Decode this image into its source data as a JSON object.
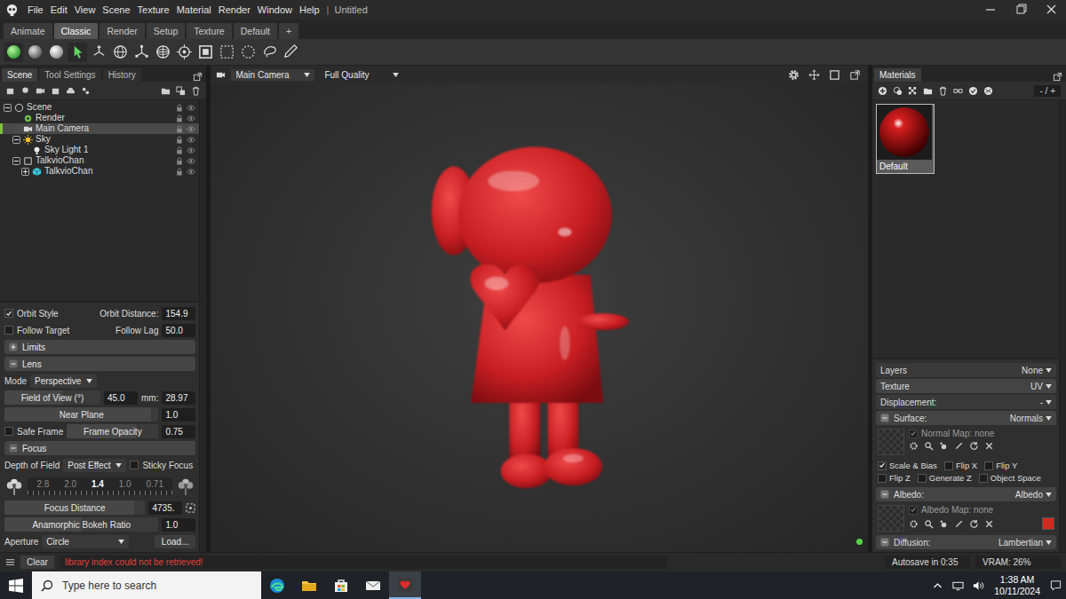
{
  "window": {
    "title": "Untitled",
    "menus": [
      "File",
      "Edit",
      "View",
      "Scene",
      "Texture",
      "Material",
      "Render",
      "Window",
      "Help"
    ],
    "separator": "|"
  },
  "workspace_tabs": [
    {
      "label": "Animate",
      "selected": false
    },
    {
      "label": "Classic",
      "selected": true
    },
    {
      "label": "Render",
      "selected": false
    },
    {
      "label": "Setup",
      "selected": false
    },
    {
      "label": "Texture",
      "selected": false
    },
    {
      "label": "Default",
      "selected": false
    },
    {
      "label": "+",
      "selected": false
    }
  ],
  "toolbar": {
    "tools": [
      {
        "kind": "shade-lit",
        "selected": true
      },
      {
        "kind": "shade-gray",
        "selected": false
      },
      {
        "kind": "shade-white",
        "selected": false
      },
      {
        "kind": "select",
        "selected": true
      },
      {
        "kind": "move",
        "selected": false
      },
      {
        "kind": "rotate",
        "selected": false
      },
      {
        "kind": "scale",
        "selected": false
      },
      {
        "kind": "transform",
        "selected": false
      },
      {
        "kind": "pivot",
        "selected": false
      },
      {
        "kind": "frame",
        "selected": false
      },
      {
        "kind": "marquee",
        "selected": false
      },
      {
        "kind": "ellipse",
        "selected": false
      },
      {
        "kind": "lasso",
        "selected": false
      },
      {
        "kind": "paint",
        "selected": false
      }
    ]
  },
  "scene_panel": {
    "tabs": [
      {
        "label": "Scene",
        "selected": true
      },
      {
        "label": "Tool Settings",
        "selected": false
      },
      {
        "label": "History",
        "selected": false
      }
    ],
    "tree": [
      {
        "label": "Scene",
        "kind": "scene",
        "expanded": true,
        "selected": false,
        "children": [
          {
            "label": "Render",
            "kind": "render",
            "selected": false
          },
          {
            "label": "Main Camera",
            "kind": "camera",
            "selected": true
          },
          {
            "label": "Sky",
            "kind": "sky",
            "expanded": true,
            "selected": false,
            "children": [
              {
                "label": "Sky Light 1",
                "kind": "light",
                "selected": false
              }
            ]
          },
          {
            "label": "TalkvioChan",
            "kind": "group",
            "expanded": true,
            "selected": false,
            "children": [
              {
                "label": "TalkvioChan",
                "kind": "mesh",
                "expanded": false,
                "selected": false,
                "children": []
              }
            ]
          }
        ]
      }
    ]
  },
  "camera": {
    "orbit_style": {
      "label": "Orbit Style",
      "checked": true
    },
    "orbit_distance": {
      "label": "Orbit Distance:",
      "value": "154.9"
    },
    "follow_target": {
      "label": "Follow Target",
      "checked": false
    },
    "follow_lag": {
      "label": "Follow Lag",
      "value": "50.0"
    },
    "limits": {
      "label": "Limits",
      "expanded": false
    },
    "lens": {
      "label": "Lens",
      "expanded": true
    },
    "mode": {
      "label": "Mode",
      "value": "Perspective"
    },
    "fov": {
      "label": "Field of View (°)",
      "value": "45.0",
      "level": 0.6,
      "unit_label": "mm:",
      "unit_value": "28.97"
    },
    "near_plane": {
      "label": "Near Plane",
      "value": "1.0",
      "level": 0.95
    },
    "safe_frame": {
      "label": "Safe Frame",
      "checked": false
    },
    "frame_opacity": {
      "label": "Frame Opacity",
      "value": "0.75",
      "level": 0.75
    },
    "focus": {
      "label": "Focus",
      "expanded": true
    },
    "depth_of_field": {
      "label": "Depth of Field",
      "value": "Post Effect"
    },
    "sticky_focus": {
      "label": "Sticky Focus",
      "checked": false
    },
    "fstops": [
      {
        "label": "2.8",
        "selected": false
      },
      {
        "label": "2.0",
        "selected": false
      },
      {
        "label": "1.4",
        "selected": true
      },
      {
        "label": "1.0",
        "selected": false
      },
      {
        "label": "0.71",
        "selected": false
      }
    ],
    "focus_distance": {
      "label": "Focus Distance",
      "value": "4735.",
      "level": 0.92
    },
    "anamorphic": {
      "label": "Anamorphic Bokeh Ratio",
      "value": "1.0",
      "level": 0.5
    },
    "aperture": {
      "label": "Aperture",
      "value": "Circle"
    },
    "load_button": "Load..."
  },
  "viewport": {
    "camera": "Main Camera",
    "quality": "Full Quality"
  },
  "materials_panel": {
    "tab": "Materials",
    "counter": "- / +",
    "materials": [
      {
        "name": "Default",
        "selected": true,
        "color": "#d81e1e"
      }
    ],
    "layers": {
      "label": "Layers",
      "value": "None"
    },
    "texture": {
      "label": "Texture",
      "value": "UV"
    },
    "displacement": {
      "label": "Displacement:",
      "value": "-"
    },
    "surface": {
      "label": "Surface:",
      "value": "Normals",
      "map_label": "Normal Map: none",
      "options": [
        {
          "label": "Scale & Bias",
          "checked": true
        },
        {
          "label": "Flip X",
          "checked": false
        },
        {
          "label": "Flip Y",
          "checked": false
        },
        {
          "label": "Flip Z",
          "checked": false
        },
        {
          "label": "Generate Z",
          "checked": false
        },
        {
          "label": "Object Space",
          "checked": false
        }
      ]
    },
    "albedo": {
      "label": "Albedo:",
      "value": "Albedo",
      "map_label": "Albedo Map: none",
      "color": "#d42a1e"
    },
    "diffusion": {
      "label": "Diffusion:",
      "value": "Lambertian"
    }
  },
  "status_bar": {
    "clear": "Clear",
    "message": "library index could not be retrieved!",
    "autosave": "Autosave in 0:35",
    "vram": "VRAM: 26%"
  },
  "taskbar": {
    "search_placeholder": "Type here to search",
    "time": "1:38 AM",
    "date": "10/11/2024",
    "apps": [
      {
        "kind": "edge",
        "active": false
      },
      {
        "kind": "explorer",
        "active": false
      },
      {
        "kind": "store",
        "active": false
      },
      {
        "kind": "mail",
        "active": false
      },
      {
        "kind": "toolbag",
        "active": true
      }
    ]
  }
}
